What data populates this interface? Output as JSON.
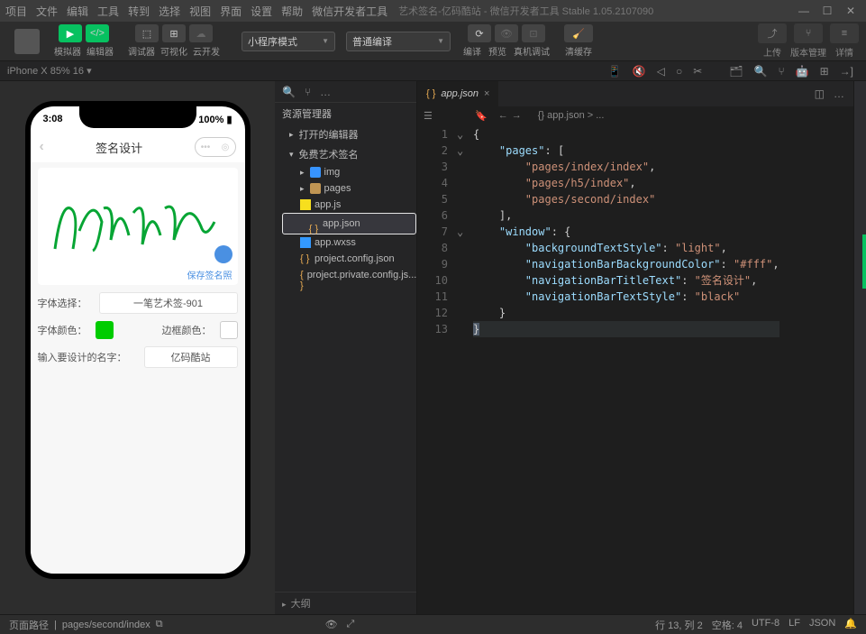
{
  "titlebar": {
    "menu": [
      "项目",
      "文件",
      "编辑",
      "工具",
      "转到",
      "选择",
      "视图",
      "界面",
      "设置",
      "帮助",
      "微信开发者工具"
    ],
    "title": "艺术签名-亿码酷站  -  微信开发者工具 Stable 1.05.2107090"
  },
  "toolbar": {
    "group_labels": [
      "模拟器",
      "编辑器",
      "调试器",
      "可视化",
      "云开发"
    ],
    "dd_mode": "小程序模式",
    "dd_compile": "普通编译",
    "compile_lbls": [
      "编译",
      "预览",
      "真机调试",
      "清缓存"
    ],
    "right_lbls": [
      "上传",
      "版本管理",
      "详情"
    ]
  },
  "subbar": {
    "device": "iPhone X 85% 16 ▾"
  },
  "simulator": {
    "time": "3:08",
    "battery": "100%",
    "nav_title": "签名设计",
    "save_label": "保存签名照",
    "font_select_lbl": "字体选择：",
    "font_name": "一笔艺术签-901",
    "font_color_lbl": "字体颜色：",
    "border_color_lbl": "边框颜色：",
    "input_lbl": "输入要设计的名字：",
    "input_val": "亿码酷站"
  },
  "explorer": {
    "title": "资源管理器",
    "nodes": {
      "open_editors": "打开的编辑器",
      "root": "免费艺术签名",
      "img": "img",
      "pages": "pages",
      "appjs": "app.js",
      "appjson": "app.json",
      "appwxss": "app.wxss",
      "pcfg": "project.config.json",
      "ppriv": "project.private.config.js..."
    },
    "outline": "大纲"
  },
  "editor": {
    "tab": "app.json",
    "breadcrumb": "{} app.json > ...",
    "lines": [
      "{",
      "  \"pages\": [",
      "    \"pages/index/index\",",
      "    \"pages/h5/index\",",
      "    \"pages/second/index\"",
      "  ],",
      "  \"window\": {",
      "    \"backgroundTextStyle\": \"light\",",
      "    \"navigationBarBackgroundColor\": \"#fff\",",
      "    \"navigationBarTitleText\": \"签名设计\",",
      "    \"navigationBarTextStyle\": \"black\"",
      "  }",
      "}"
    ]
  },
  "statusbar": {
    "path_lbl": "页面路径",
    "path": "pages/second/index",
    "right": [
      "行 13, 列 2",
      "空格: 4",
      "UTF-8",
      "LF",
      "JSON"
    ]
  }
}
